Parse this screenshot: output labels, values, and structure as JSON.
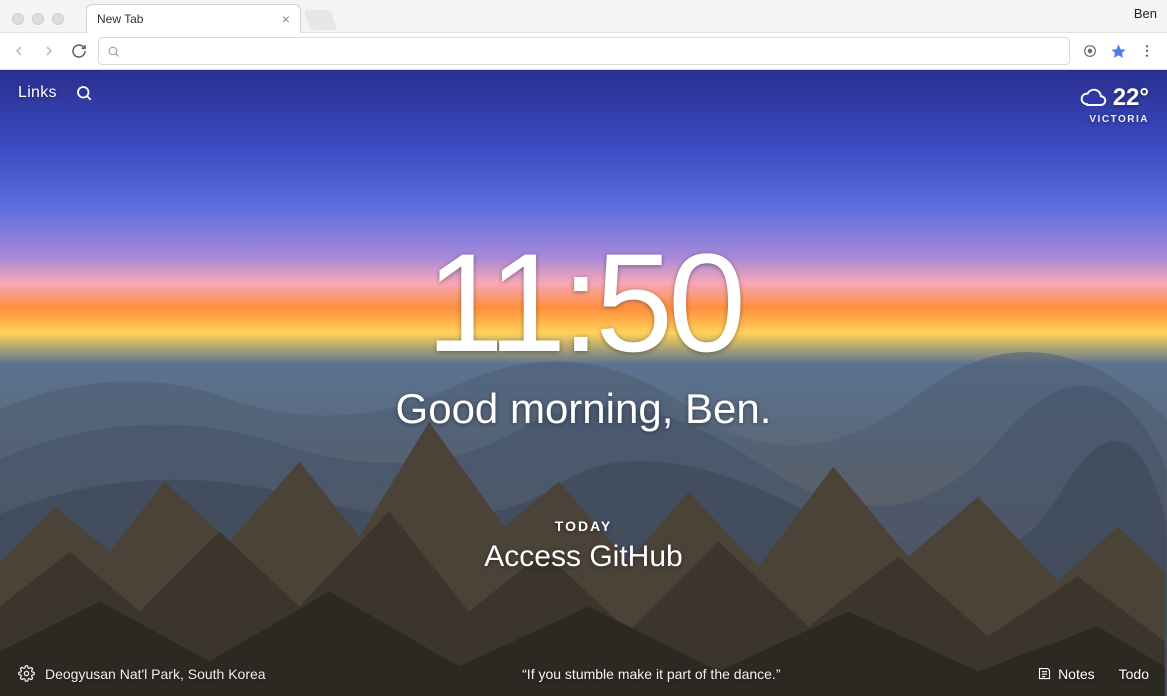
{
  "browser": {
    "tab_title": "New Tab",
    "profile_name": "Ben"
  },
  "dashboard": {
    "top": {
      "links_label": "Links"
    },
    "weather": {
      "temp": "22°",
      "location": "VICTORIA"
    },
    "clock": "11:50",
    "greeting": "Good morning, Ben.",
    "focus": {
      "label": "TODAY",
      "text": "Access GitHub"
    },
    "photo_location": "Deogyusan Nat'l Park, South Korea",
    "quote": "“If you stumble make it part of the dance.”",
    "notes_label": "Notes",
    "todo_label": "Todo"
  }
}
